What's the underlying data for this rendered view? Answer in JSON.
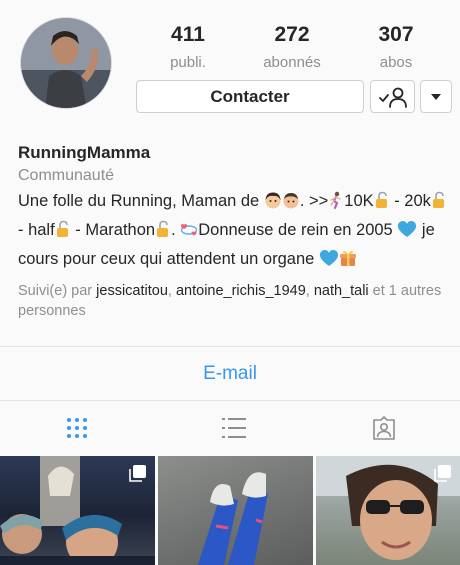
{
  "profile": {
    "stats": [
      {
        "count": "411",
        "label": "publi."
      },
      {
        "count": "272",
        "label": "abonnés"
      },
      {
        "count": "307",
        "label": "abos"
      }
    ],
    "contact_label": "Contacter",
    "username": "RunningMamma",
    "category": "Communauté",
    "bio": {
      "t1": "Une folle du Running, Maman de ",
      "t2": ". >>",
      "t3": "10K",
      "t4": " - 20k",
      "t5": " - half",
      "t6": " - Marathon",
      "t7": ". ",
      "t8": "Donneuse de rein en 2005 ",
      "t9": " je cours pour ceux qui attendent un organe "
    },
    "followed_by": {
      "prefix": "Suivi(e) par ",
      "user1": "jessicatitou",
      "sep1": ", ",
      "user2": "antoine_richis_1949",
      "sep2": ", ",
      "user3": "nath_tali",
      "suffix": " et 1 autres personnes"
    }
  },
  "email_label": "E-mail",
  "icons": {
    "follow": "person-check-icon",
    "more": "caret-down-icon",
    "grid_tab": "grid-icon",
    "list_tab": "list-icon",
    "tagged_tab": "tagged-icon",
    "multi": "multiple-photos-icon"
  },
  "colors": {
    "accent": "#3897f0",
    "secondary_text": "#8e8e8e",
    "primary_text": "#262626",
    "heart": "#3ea6e0"
  }
}
